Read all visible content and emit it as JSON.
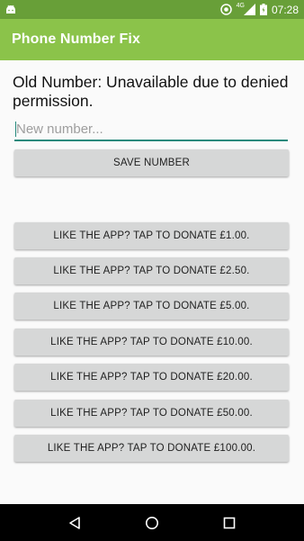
{
  "status_bar": {
    "time": "07:28",
    "network": "4G",
    "icons": [
      "android-icon",
      "sync-icon",
      "signal-icon",
      "battery-icon"
    ]
  },
  "app_bar": {
    "title": "Phone Number Fix",
    "color": "#8bc34a",
    "status_color": "#689f38"
  },
  "main": {
    "old_number_text": "Old Number: Unavailable due to denied permission.",
    "new_number_placeholder": "New number...",
    "new_number_value": "",
    "save_button_label": "SAVE NUMBER",
    "accent_color": "#26897c",
    "donate_buttons": [
      "LIKE THE APP? TAP TO DONATE £1.00.",
      "LIKE THE APP? TAP TO DONATE £2.50.",
      "LIKE THE APP? TAP TO DONATE £5.00.",
      "LIKE THE APP? TAP TO DONATE £10.00.",
      "LIKE THE APP? TAP TO DONATE £20.00.",
      "LIKE THE APP? TAP TO DONATE £50.00.",
      "LIKE THE APP? TAP TO DONATE £100.00."
    ]
  },
  "nav_bar": {
    "icons": [
      "back-icon",
      "home-icon",
      "recents-icon"
    ]
  }
}
